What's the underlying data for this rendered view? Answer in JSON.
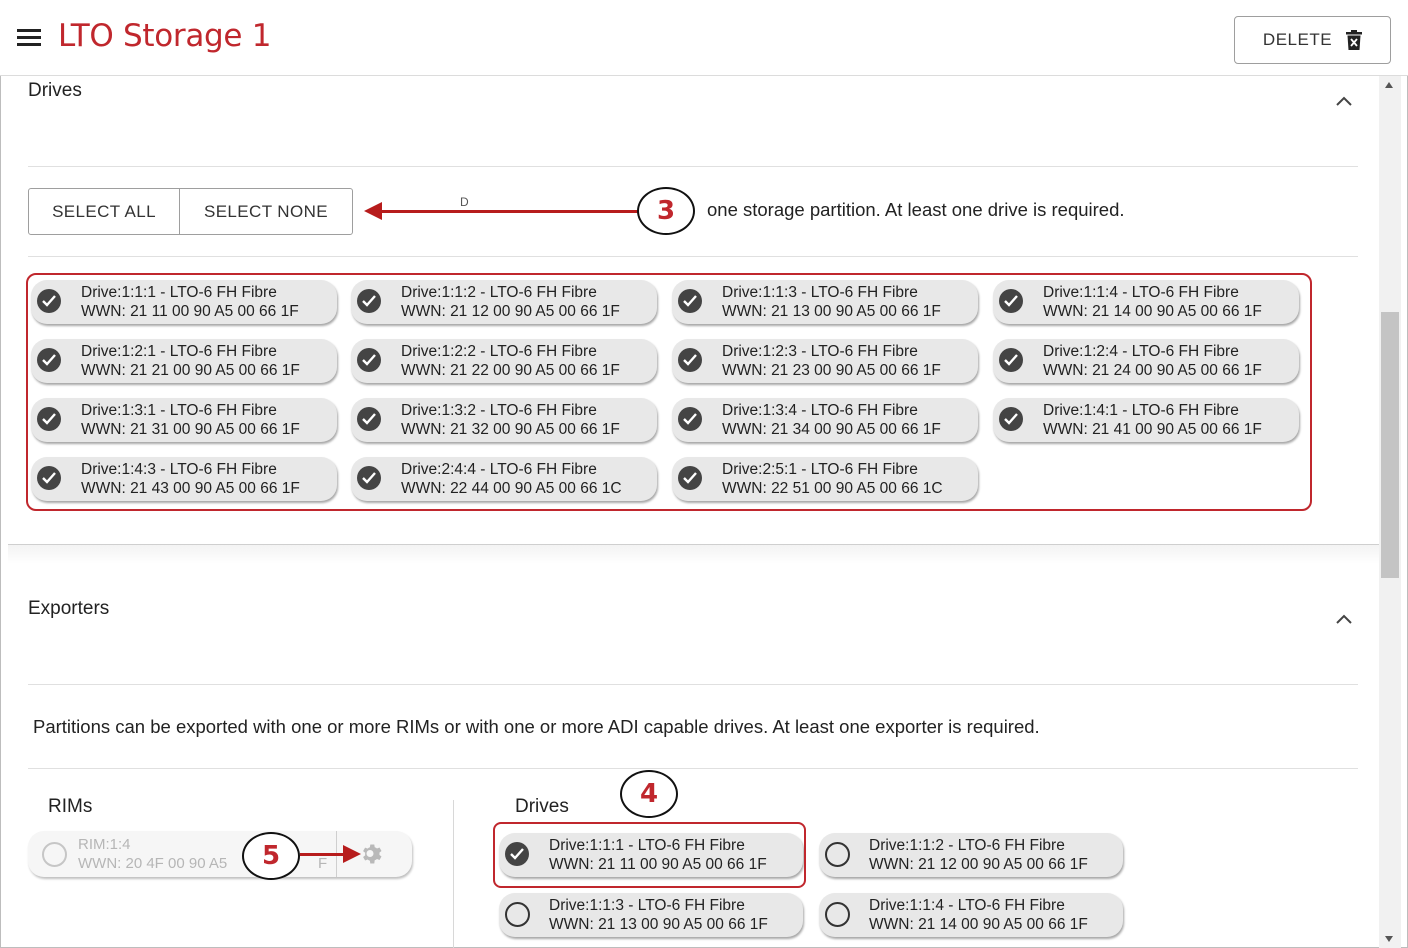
{
  "header": {
    "title": "LTO Storage 1",
    "delete_label": "DELETE"
  },
  "drives_section": {
    "title": "Drives",
    "select_all": "SELECT ALL",
    "select_none": "SELECT NONE",
    "helper_text_prefix": "D",
    "helper_text": "one storage partition. At least one drive is required.",
    "drives": [
      {
        "line1": "Drive:1:1:1 - LTO-6 FH Fibre",
        "line2": "WWN: 21 11 00 90 A5 00 66 1F",
        "selected": true
      },
      {
        "line1": "Drive:1:1:2 - LTO-6 FH Fibre",
        "line2": "WWN: 21 12 00 90 A5 00 66 1F",
        "selected": true
      },
      {
        "line1": "Drive:1:1:3 - LTO-6 FH Fibre",
        "line2": "WWN: 21 13 00 90 A5 00 66 1F",
        "selected": true
      },
      {
        "line1": "Drive:1:1:4 - LTO-6 FH Fibre",
        "line2": "WWN: 21 14 00 90 A5 00 66 1F",
        "selected": true
      },
      {
        "line1": "Drive:1:2:1 - LTO-6 FH Fibre",
        "line2": "WWN: 21 21 00 90 A5 00 66 1F",
        "selected": true
      },
      {
        "line1": "Drive:1:2:2 - LTO-6 FH Fibre",
        "line2": "WWN: 21 22 00 90 A5 00 66 1F",
        "selected": true
      },
      {
        "line1": "Drive:1:2:3 - LTO-6 FH Fibre",
        "line2": "WWN: 21 23 00 90 A5 00 66 1F",
        "selected": true
      },
      {
        "line1": "Drive:1:2:4 - LTO-6 FH Fibre",
        "line2": "WWN: 21 24 00 90 A5 00 66 1F",
        "selected": true
      },
      {
        "line1": "Drive:1:3:1 - LTO-6 FH Fibre",
        "line2": "WWN: 21 31 00 90 A5 00 66 1F",
        "selected": true
      },
      {
        "line1": "Drive:1:3:2 - LTO-6 FH Fibre",
        "line2": "WWN: 21 32 00 90 A5 00 66 1F",
        "selected": true
      },
      {
        "line1": "Drive:1:3:4 - LTO-6 FH Fibre",
        "line2": "WWN: 21 34 00 90 A5 00 66 1F",
        "selected": true
      },
      {
        "line1": "Drive:1:4:1 - LTO-6 FH Fibre",
        "line2": "WWN: 21 41 00 90 A5 00 66 1F",
        "selected": true
      },
      {
        "line1": "Drive:1:4:3 - LTO-6 FH Fibre",
        "line2": "WWN: 21 43 00 90 A5 00 66 1F",
        "selected": true
      },
      {
        "line1": "Drive:2:4:4 - LTO-6 FH Fibre",
        "line2": "WWN: 22 44 00 90 A5 00 66 1C",
        "selected": true
      },
      {
        "line1": "Drive:2:5:1 - LTO-6 FH Fibre",
        "line2": "WWN: 22 51 00 90 A5 00 66 1C",
        "selected": true
      }
    ]
  },
  "exporters_section": {
    "title": "Exporters",
    "helper_text": "Partitions can be exported with one or more RIMs or with one or more ADI capable drives. At least one exporter is required.",
    "rims_label": "RIMs",
    "rim": {
      "line1": "RIM:1:4",
      "line2": "WWN: 20 4F 00 90 A5",
      "line2_tail": "F"
    },
    "drives_label": "Drives",
    "drives": [
      {
        "line1": "Drive:1:1:1 - LTO-6 FH Fibre",
        "line2": "WWN: 21 11 00 90 A5 00 66 1F",
        "selected": true
      },
      {
        "line1": "Drive:1:1:2 - LTO-6 FH Fibre",
        "line2": "WWN: 21 12 00 90 A5 00 66 1F",
        "selected": false
      },
      {
        "line1": "Drive:1:1:3 - LTO-6 FH Fibre",
        "line2": "WWN: 21 13 00 90 A5 00 66 1F",
        "selected": false
      },
      {
        "line1": "Drive:1:1:4 - LTO-6 FH Fibre",
        "line2": "WWN: 21 14 00 90 A5 00 66 1F",
        "selected": false
      }
    ]
  },
  "callouts": [
    "3",
    "4",
    "5"
  ],
  "colors": {
    "accent": "#c0272d",
    "arrow": "#b71c1c"
  }
}
